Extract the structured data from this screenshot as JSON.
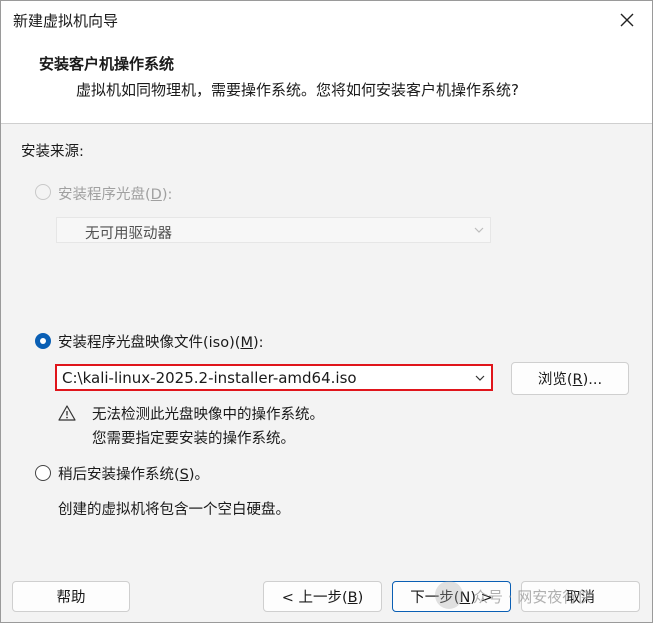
{
  "window": {
    "title": "新建虚拟机向导",
    "close_icon": "close-icon"
  },
  "header": {
    "title": "安装客户机操作系统",
    "subtitle": "虚拟机如同物理机，需要操作系统。您将如何安装客户机操作系统?"
  },
  "source": {
    "label": "安装来源:",
    "disc_option": {
      "label": "安装程序光盘(",
      "mnemonic": "D",
      "suffix": "):",
      "enabled": false,
      "selected": false
    },
    "disc_drive": {
      "value": "无可用驱动器",
      "enabled": false
    },
    "iso_option": {
      "label": "安装程序光盘映像文件(iso)(",
      "mnemonic": "M",
      "suffix": "):",
      "selected": true
    },
    "iso_path": {
      "value": "C:\\kali-linux-2025.2-installer-amd64.iso"
    },
    "browse_button": {
      "label": "浏览(",
      "mnemonic": "R",
      "suffix": ")..."
    },
    "warning": {
      "icon": "warning-icon",
      "line1": "无法检测此光盘映像中的操作系统。",
      "line2": "您需要指定要安装的操作系统。"
    },
    "later_option": {
      "label": "稍后安装操作系统(",
      "mnemonic": "S",
      "suffix": ")。",
      "selected": false,
      "description": "创建的虚拟机将包含一个空白硬盘。"
    }
  },
  "footer": {
    "help_label": "帮助",
    "back_label": "< 上一步(",
    "back_mnemonic": "B",
    "back_suffix": ")",
    "next_label": "下一步(",
    "next_mnemonic": "N",
    "next_suffix": ") >",
    "cancel_label": "取消"
  },
  "watermark": {
    "text": "众号 · 网安夜行侠"
  },
  "colors": {
    "accent": "#0a5fb4",
    "highlight_border": "#e0151b"
  }
}
